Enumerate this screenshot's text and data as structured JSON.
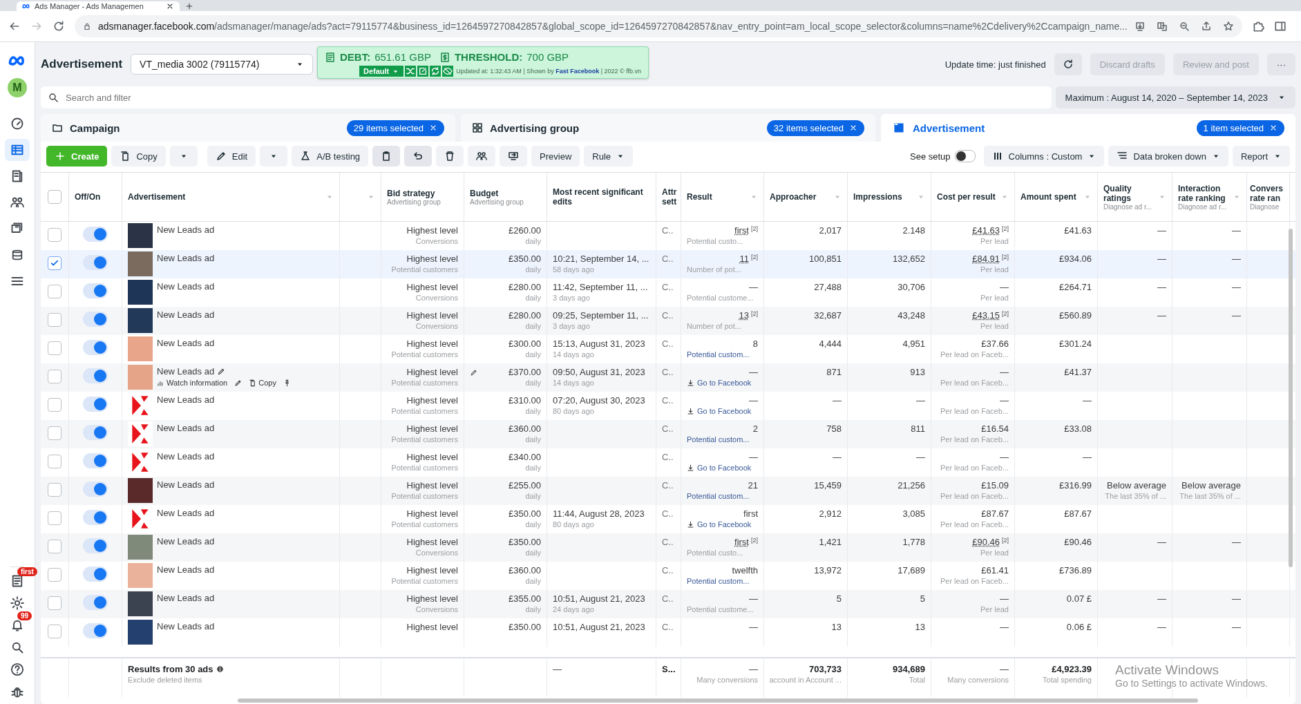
{
  "browser": {
    "tab_title": "Ads Manager - Ads Managemen",
    "url_host": "adsmanager.facebook.com",
    "url_path": "/adsmanager/manage/ads?act=79115774&business_id=1264597270842857&global_scope_id=1264597270842857&nav_entry_point=am_local_scope_selector&columns=name%2Cdelivery%2Ccampaign_name..."
  },
  "sidebar": {
    "avatar": "M",
    "items": [
      {
        "selected": false
      },
      {
        "selected": true
      },
      {
        "selected": false
      },
      {
        "selected": false
      },
      {
        "selected": false
      },
      {
        "selected": false
      },
      {
        "selected": false
      }
    ],
    "reports_badge": "first",
    "alerts_badge": "99"
  },
  "header": {
    "title": "Advertisement",
    "account": "VT_media 3002 (79115774)",
    "update_time": "Update time: just finished",
    "discard": {
      "label": "Discard drafts",
      "disabled": true
    },
    "review": {
      "label": "Review and post",
      "disabled": true
    },
    "more": "···"
  },
  "extension": {
    "debt_label": "DEBT:",
    "debt": "651.61 GBP",
    "threshold_label": "THRESHOLD:",
    "threshold": "700 GBP",
    "preset": "Default",
    "note": "Updated at: 1:32:43 AM | Shown by **Fast Facebook** | 2022 © ffb.vn"
  },
  "search": {
    "placeholder": "Search and filter"
  },
  "date_range": "Maximum : August 14, 2020 – September 14, 2023",
  "levels": [
    {
      "label": "Campaign",
      "badge": "29 items selected",
      "selected": false
    },
    {
      "label": "Advertising group",
      "badge": "32 items selected",
      "selected": false
    },
    {
      "label": "Advertisement",
      "badge": "1 item selected",
      "selected": true
    }
  ],
  "toolbar": {
    "create": "Create",
    "copy": "Copy",
    "edit": "Edit",
    "ab": "A/B testing",
    "preview": "Preview",
    "rule": "Rule",
    "see_setup": "See setup",
    "see_setup_on": false,
    "columns": "Columns : Custom",
    "breakdown": "Data broken down",
    "report": "Report"
  },
  "columns": [
    {
      "kind": "check",
      "checked": false
    },
    {
      "kind": "toggle",
      "title": "Off/On",
      "sortable": false
    },
    {
      "kind": "ad",
      "title": "Advertisement",
      "sortable": true
    },
    {
      "kind": "blank",
      "sortable": true
    },
    {
      "kind": "bid",
      "title": "Bid strategy",
      "sub": "Advertising group",
      "sortable": false
    },
    {
      "kind": "budget",
      "title": "Budget",
      "sub": "Advertising group",
      "sortable": false
    },
    {
      "kind": "edits",
      "title": "Most recent significant edits",
      "sortable": false
    },
    {
      "kind": "attr",
      "title": "Attr sett",
      "sortable": false
    },
    {
      "kind": "result",
      "title": "Result",
      "sortable": true
    },
    {
      "kind": "reach",
      "title": "Approacher",
      "sortable": true
    },
    {
      "kind": "impr",
      "title": "Impressions",
      "sortable": true
    },
    {
      "kind": "cost",
      "title": "Cost per result",
      "sortable": true
    },
    {
      "kind": "amount",
      "title": "Amount spent",
      "sortable": true
    },
    {
      "kind": "quality",
      "title": "Quality ratings",
      "sub": "Diagnose ad r...",
      "sortable": true
    },
    {
      "kind": "interaction",
      "title": "Interaction rate ranking",
      "sub": "Diagnose ad r...",
      "sortable": true
    },
    {
      "kind": "conv",
      "title": "Convers rate ran",
      "sub": "Diagnose",
      "sortable": false
    }
  ],
  "rows": [
    {
      "checked": false,
      "on": true,
      "thumb": {
        "kind": "photo"
      },
      "name": "New Leads ad",
      "hovered": false,
      "bid": "Highest level",
      "bid_sub": "Conversions",
      "budget": "£260.00",
      "budget_sub": "daily",
      "attr": "C..",
      "result": "first",
      "result_note": "[2]",
      "result_sub": {
        "kind": "text",
        "text": "Potential custo..."
      },
      "reach": "2,017",
      "impr": "2.148",
      "cost": "£41.63",
      "cost_note": "[2]",
      "cost_sub": "Per lead",
      "amount": "£41.63",
      "quality": "—",
      "interaction": "—"
    },
    {
      "checked": true,
      "on": true,
      "thumb": {
        "kind": "photo"
      },
      "name": "New Leads ad",
      "hovered": false,
      "bid": "Highest level",
      "bid_sub": "Potential customers",
      "budget": "£350.00",
      "budget_sub": "daily",
      "edit": "10:21, September 14, ...",
      "edit_ago": "58 days ago",
      "attr": "C..",
      "result": "11",
      "result_note": "[2]",
      "result_sub": {
        "kind": "text",
        "text": "Number of pot..."
      },
      "reach": "100,851",
      "impr": "132,652",
      "cost": "£84.91",
      "cost_note": "[2]",
      "cost_sub": "Per lead",
      "amount": "£934.06",
      "quality": "—",
      "interaction": "—"
    },
    {
      "checked": false,
      "on": true,
      "thumb": {
        "kind": "photo"
      },
      "name": "New Leads ad",
      "hovered": false,
      "bid": "Highest level",
      "bid_sub": "Conversions",
      "budget": "£280.00",
      "budget_sub": "daily",
      "edit": "11:42, September 11, ...",
      "edit_ago": "3 days ago",
      "attr": "C..",
      "result": "—",
      "result_sub": {
        "kind": "text",
        "text": "Potential custome..."
      },
      "reach": "27,488",
      "impr": "30,706",
      "cost": "—",
      "cost_sub": "Per lead",
      "amount": "£264.71",
      "quality": "—",
      "interaction": "—"
    },
    {
      "checked": false,
      "on": true,
      "thumb": {
        "kind": "photo"
      },
      "name": "New Leads ad",
      "hovered": false,
      "bid": "Highest level",
      "bid_sub": "Conversions",
      "budget": "£280.00",
      "budget_sub": "daily",
      "edit": "09:25, September 11, ...",
      "edit_ago": "3 days ago",
      "attr": "C..",
      "result": "13",
      "result_note": "[2]",
      "result_sub": {
        "kind": "text",
        "text": "Number of pot..."
      },
      "reach": "32,687",
      "impr": "43,248",
      "cost": "£43.15",
      "cost_note": "[2]",
      "cost_sub": "Per lead",
      "amount": "£560.89",
      "quality": "—",
      "interaction": "—"
    },
    {
      "checked": false,
      "on": true,
      "thumb": {
        "kind": "photo"
      },
      "name": "New Leads ad",
      "hovered": false,
      "bid": "Highest level",
      "bid_sub": "Potential customers",
      "budget": "£300.00",
      "budget_sub": "daily",
      "edit": "15:13, August 31, 2023",
      "edit_ago": "14 days ago",
      "attr": "C..",
      "result": "8",
      "result_sub": {
        "kind": "link",
        "text": "Potential custom..."
      },
      "reach": "4,444",
      "impr": "4,951",
      "cost": "£37.66",
      "cost_sub": "Per lead on Faceb...",
      "amount": "£301.24"
    },
    {
      "checked": false,
      "on": true,
      "thumb": {
        "kind": "photo"
      },
      "name": "New Leads ad",
      "hovered": true,
      "actions": [
        {
          "kind": "watch",
          "label": "Watch information"
        },
        {
          "kind": "edit"
        },
        {
          "kind": "copy",
          "label": "Copy"
        },
        {
          "kind": "pin"
        }
      ],
      "bid": "Highest level",
      "bid_sub": "Potential customers",
      "budget": "£370.00",
      "budget_sub": "daily",
      "edit": "09:50, August 31, 2023",
      "edit_ago": "14 days ago",
      "attr": "C..",
      "result": "—",
      "result_sub": {
        "kind": "goto",
        "text": "Go to Facebook"
      },
      "reach": "871",
      "impr": "913",
      "cost": "—",
      "cost_sub": "Per lead on Faceb...",
      "amount": "£41.37"
    },
    {
      "checked": false,
      "on": true,
      "thumb": {
        "kind": "logo"
      },
      "name": "New Leads ad",
      "hovered": false,
      "bid": "Highest level",
      "bid_sub": "Potential customers",
      "budget": "£310.00",
      "budget_sub": "daily",
      "edit": "07:20, August 30, 2023",
      "edit_ago": "80 days ago",
      "attr": "C..",
      "result": "—",
      "result_sub": {
        "kind": "goto",
        "text": "Go to Facebook"
      },
      "reach": "—",
      "impr": "—",
      "cost": "—",
      "cost_sub": "Per lead on Faceb...",
      "amount": "—"
    },
    {
      "checked": false,
      "on": true,
      "thumb": {
        "kind": "logo"
      },
      "name": "New Leads ad",
      "hovered": false,
      "bid": "Highest level",
      "bid_sub": "Potential customers",
      "budget": "£360.00",
      "budget_sub": "daily",
      "attr": "C..",
      "result": "2",
      "result_sub": {
        "kind": "link",
        "text": "Potential custom..."
      },
      "reach": "758",
      "impr": "811",
      "cost": "£16.54",
      "cost_sub": "Per lead on Faceb...",
      "amount": "£33.08"
    },
    {
      "checked": false,
      "on": true,
      "thumb": {
        "kind": "logo"
      },
      "name": "New Leads ad",
      "hovered": false,
      "bid": "Highest level",
      "bid_sub": "Potential customers",
      "budget": "£340.00",
      "budget_sub": "daily",
      "attr": "C..",
      "result": "—",
      "result_sub": {
        "kind": "goto",
        "text": "Go to Facebook"
      },
      "reach": "—",
      "impr": "—",
      "cost": "—",
      "cost_sub": "Per lead on Faceb...",
      "amount": "—"
    },
    {
      "checked": false,
      "on": true,
      "thumb": {
        "kind": "photo"
      },
      "name": "New Leads ad",
      "hovered": false,
      "bid": "Highest level",
      "bid_sub": "Potential customers",
      "budget": "£255.00",
      "budget_sub": "daily",
      "attr": "C..",
      "result": "21",
      "result_sub": {
        "kind": "link",
        "text": "Potential custom..."
      },
      "reach": "15,459",
      "impr": "21,256",
      "cost": "£15.09",
      "cost_sub": "Per lead on Faceb...",
      "amount": "£316.99",
      "quality": "Below average",
      "quality_sub": "The last 35% of ...",
      "interaction": "Below average",
      "interaction_sub": "The last 35% of ..."
    },
    {
      "checked": false,
      "on": true,
      "thumb": {
        "kind": "logo"
      },
      "name": "New Leads ad",
      "hovered": false,
      "bid": "Highest level",
      "bid_sub": "Potential customers",
      "budget": "£350.00",
      "budget_sub": "daily",
      "edit": "11:44, August 28, 2023",
      "edit_ago": "80 days ago",
      "attr": "C..",
      "result": "first",
      "result_sub": {
        "kind": "goto",
        "text": "Go to Facebook"
      },
      "reach": "2,912",
      "impr": "3,085",
      "cost": "£87.67",
      "cost_sub": "Per lead on Faceb...",
      "amount": "£87.67"
    },
    {
      "checked": false,
      "on": true,
      "thumb": {
        "kind": "photo"
      },
      "name": "New Leads ad",
      "hovered": false,
      "bid": "Highest level",
      "bid_sub": "Conversions",
      "budget": "£350.00",
      "budget_sub": "daily",
      "attr": "C..",
      "result": "first",
      "result_note": "[2]",
      "result_sub": {
        "kind": "text",
        "text": "Potential custo..."
      },
      "reach": "1,421",
      "impr": "1,778",
      "cost": "£90.46",
      "cost_note": "[2]",
      "cost_sub": "Per lead",
      "amount": "£90.46",
      "quality": "—",
      "interaction": "—"
    },
    {
      "checked": false,
      "on": true,
      "thumb": {
        "kind": "photo"
      },
      "name": "New Leads ad",
      "hovered": false,
      "bid": "Highest level",
      "bid_sub": "Potential customers",
      "budget": "£360.00",
      "budget_sub": "daily",
      "attr": "C..",
      "result": "twelfth",
      "result_sub": {
        "kind": "link",
        "text": "Potential custom..."
      },
      "reach": "13,972",
      "impr": "17,689",
      "cost": "£61.41",
      "cost_sub": "Per lead on Faceb...",
      "amount": "£736.89"
    },
    {
      "checked": false,
      "on": true,
      "thumb": {
        "kind": "photo"
      },
      "name": "New Leads ad",
      "hovered": false,
      "bid": "Highest level",
      "bid_sub": "Conversions",
      "budget": "£355.00",
      "budget_sub": "daily",
      "edit": "10:51, August 21, 2023",
      "edit_ago": "24 days ago",
      "attr": "C..",
      "result": "—",
      "result_sub": {
        "kind": "text",
        "text": "Potential custome..."
      },
      "reach": "5",
      "impr": "5",
      "cost": "—",
      "cost_sub": "Per lead",
      "amount": "0.07 £",
      "quality": "—",
      "interaction": "—"
    },
    {
      "checked": false,
      "on": true,
      "thumb": {
        "kind": "photo"
      },
      "name": "New Leads ad",
      "hovered": false,
      "bid": "Highest level",
      "budget": "£350.00",
      "edit": "10:51, August 21, 2023",
      "attr": "C..",
      "result": "—",
      "reach": "13",
      "impr": "13",
      "cost": "—",
      "amount": "0.06 £",
      "quality": "—",
      "interaction": "—"
    }
  ],
  "footer": {
    "title": "Results from 30 ads",
    "sub": "Exclude deleted items",
    "edit": "—",
    "attr": "S...",
    "result": "—",
    "result_sub": "Many conversions",
    "reach": "703,733",
    "reach_sub": "account in Account ...",
    "impr": "934,689",
    "impr_sub": "Total",
    "cost": "—",
    "cost_sub": "Many conversions",
    "amount": "£4,923.39",
    "amount_sub": "Total spending"
  },
  "os_notice": {
    "title": "Activate Windows",
    "text": "Go to Settings to activate Windows."
  }
}
